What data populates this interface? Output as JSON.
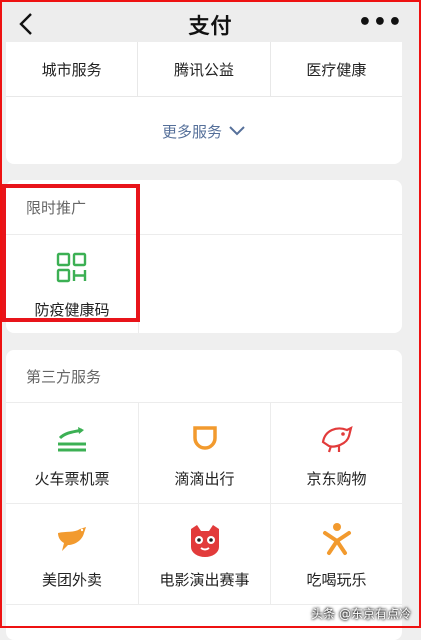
{
  "header": {
    "title": "支付"
  },
  "services_top": {
    "items": [
      {
        "label": "城市服务"
      },
      {
        "label": "腾讯公益"
      },
      {
        "label": "医疗健康"
      }
    ],
    "more_label": "更多服务"
  },
  "promo": {
    "section_title": "限时推广",
    "item_label": "防疫健康码"
  },
  "third_party": {
    "section_title": "第三方服务",
    "items": [
      {
        "label": "火车票机票",
        "icon": "train-icon"
      },
      {
        "label": "滴滴出行",
        "icon": "didi-icon"
      },
      {
        "label": "京东购物",
        "icon": "jd-dog-icon"
      },
      {
        "label": "美团外卖",
        "icon": "kangaroo-icon"
      },
      {
        "label": "电影演出赛事",
        "icon": "cat-face-icon"
      },
      {
        "label": "吃喝玩乐",
        "icon": "person-icon"
      }
    ]
  },
  "watermark": {
    "text": "头条 @东京有点冷"
  },
  "colors": {
    "green": "#3cb054",
    "orange": "#f29a2e",
    "red_highlight": "#e8141a",
    "link": "#56709a"
  }
}
